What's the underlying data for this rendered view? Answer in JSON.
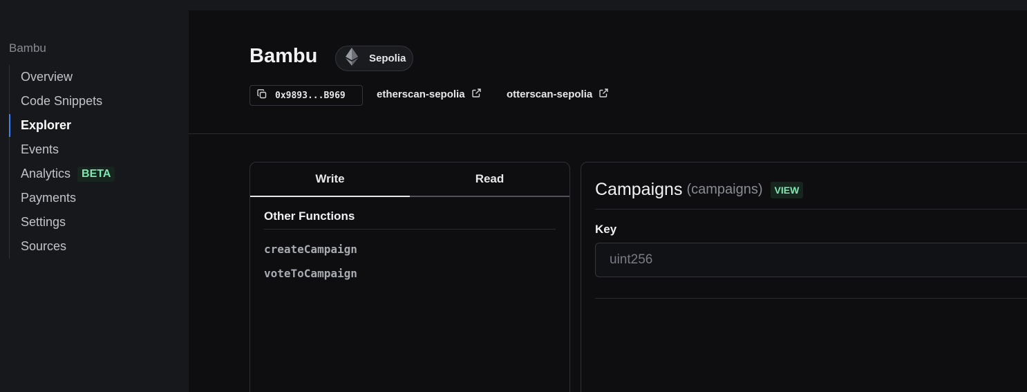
{
  "sidebar": {
    "title": "Bambu",
    "items": [
      {
        "label": "Overview"
      },
      {
        "label": "Code Snippets"
      },
      {
        "label": "Explorer",
        "active": true
      },
      {
        "label": "Events"
      },
      {
        "label": "Analytics",
        "badge": "BETA"
      },
      {
        "label": "Payments"
      },
      {
        "label": "Settings"
      },
      {
        "label": "Sources"
      }
    ]
  },
  "header": {
    "contract_name": "Bambu",
    "network": {
      "label": "Sepolia",
      "icon": "ethereum-icon"
    },
    "address": {
      "text": "0x9893...B969",
      "icon": "copy-icon"
    },
    "links": [
      {
        "label": "etherscan-sepolia",
        "icon": "external-link-icon"
      },
      {
        "label": "otterscan-sepolia",
        "icon": "external-link-icon"
      }
    ]
  },
  "functions_panel": {
    "tabs": [
      {
        "label": "Write",
        "active": true
      },
      {
        "label": "Read",
        "active": false
      }
    ],
    "section_title": "Other Functions",
    "functions": [
      "createCampaign",
      "voteToCampaign"
    ]
  },
  "detail": {
    "title": "Campaigns",
    "subtitle": "(campaigns)",
    "badge": "VIEW",
    "key_label": "Key",
    "key_placeholder": "uint256"
  },
  "colors": {
    "accent": "#3b82f6",
    "badge_text": "#7fe8b1",
    "badge_bg": "#16261f",
    "background": "#0e0e10",
    "sidebar_bg": "#17181c"
  }
}
